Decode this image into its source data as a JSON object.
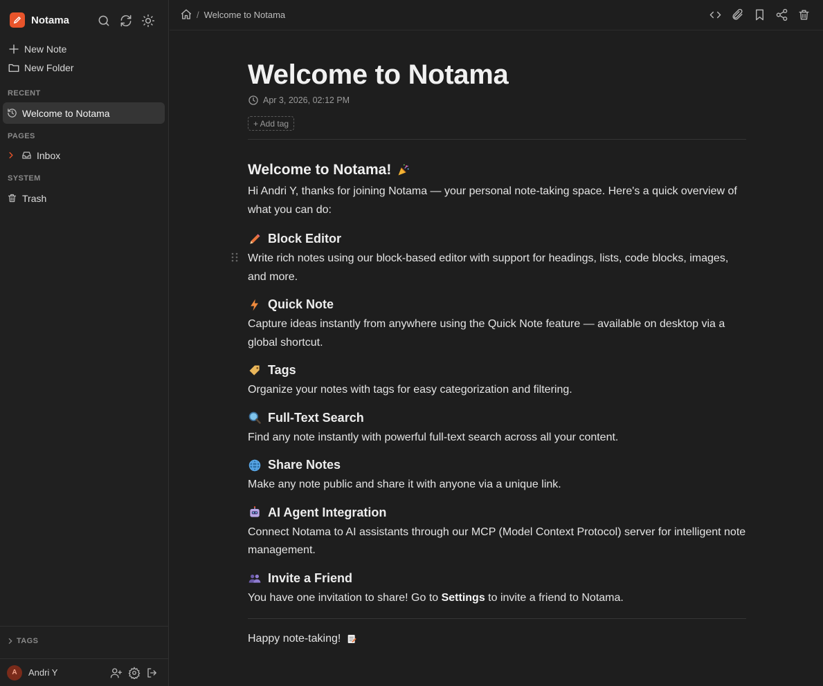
{
  "app": {
    "name": "Notama"
  },
  "sidebar": {
    "new_note": "New Note",
    "new_folder": "New Folder",
    "recent_label": "RECENT",
    "recent_items": [
      "Welcome to Notama"
    ],
    "pages_label": "PAGES",
    "page_items": [
      "Inbox"
    ],
    "system_label": "SYSTEM",
    "system_items": [
      "Trash"
    ],
    "tags_label": "TAGS"
  },
  "user": {
    "name": "Andri Y",
    "initial": "A"
  },
  "breadcrumb": {
    "separator": "/",
    "current": "Welcome to Notama"
  },
  "note": {
    "title": "Welcome to Notama",
    "date": "Apr 3, 2026, 02:12 PM",
    "add_tag": "+ Add tag",
    "heading": "Welcome to Notama!",
    "intro": "Hi Andri Y, thanks for joining Notama — your personal note-taking space. Here's a quick overview of what you can do:",
    "sections": [
      {
        "icon": "pencil-emoji",
        "title": "Block Editor",
        "text": "Write rich notes using our block-based editor with support for headings, lists, code blocks, images, and more."
      },
      {
        "icon": "lightning-emoji",
        "title": "Quick Note",
        "text": "Capture ideas instantly from anywhere using the Quick Note feature — available on desktop via a global shortcut."
      },
      {
        "icon": "label-emoji",
        "title": "Tags",
        "text": "Organize your notes with tags for easy categorization and filtering."
      },
      {
        "icon": "magnifier-emoji",
        "title": "Full-Text Search",
        "text": "Find any note instantly with powerful full-text search across all your content."
      },
      {
        "icon": "globe-emoji",
        "title": "Share Notes",
        "text": "Make any note public and share it with anyone via a unique link."
      },
      {
        "icon": "robot-emoji",
        "title": "AI Agent Integration",
        "text": "Connect Notama to AI assistants through our MCP (Model Context Protocol) server for intelligent note management."
      },
      {
        "icon": "people-emoji",
        "title": "Invite a Friend",
        "text_before": "You have one invitation to share! Go to ",
        "text_bold": "Settings",
        "text_after": " to invite a friend to Notama."
      }
    ],
    "closing": "Happy note-taking!"
  },
  "colors": {
    "accent": "#e8542b",
    "background": "#1e1e1e",
    "sidebar": "#202020"
  }
}
